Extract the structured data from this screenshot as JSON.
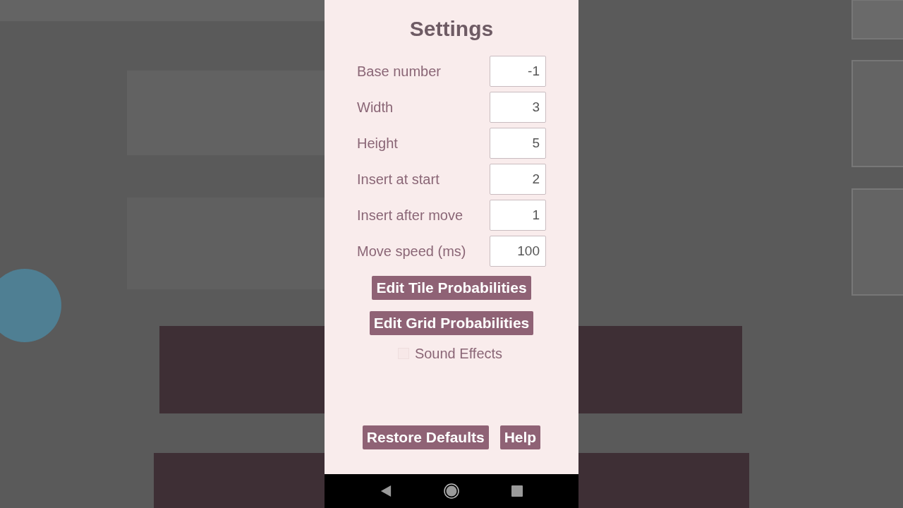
{
  "title": "Settings",
  "fields": [
    {
      "label": "Base number",
      "value": "-1"
    },
    {
      "label": "Width",
      "value": "3"
    },
    {
      "label": "Height",
      "value": "5"
    },
    {
      "label": "Insert at start",
      "value": "2"
    },
    {
      "label": "Insert after move",
      "value": "1"
    },
    {
      "label": "Move speed (ms)",
      "value": "100"
    }
  ],
  "buttons": [
    "Edit Tile Probabilities",
    "Edit Grid Probabilities"
  ],
  "sound_effects": {
    "label": "Sound Effects",
    "checked": false
  },
  "footer_buttons": [
    "Restore Defaults",
    "Help"
  ]
}
